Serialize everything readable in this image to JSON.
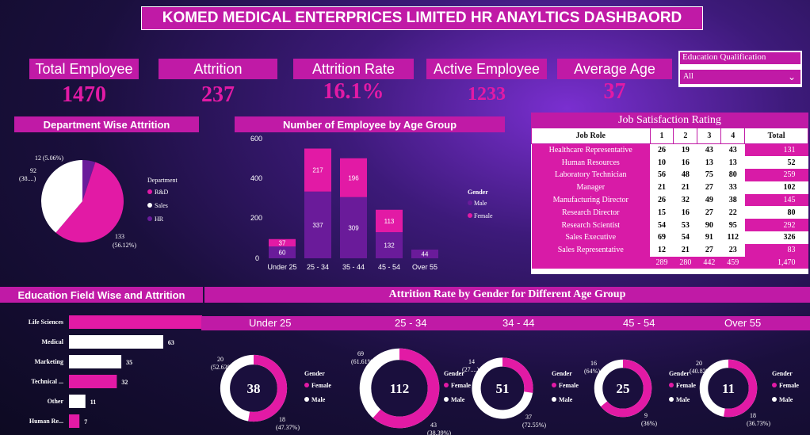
{
  "title": "KOMED MEDICAL ENTERPRICES LIMITED HR ANAYLTICS DASHBAORD",
  "kpis": [
    {
      "label": "Total Employee",
      "value": "1470"
    },
    {
      "label": "Attrition",
      "value": "237"
    },
    {
      "label": "Attrition Rate",
      "value": "16.1%"
    },
    {
      "label": "Active Employee",
      "value": "1233"
    },
    {
      "label": "Average Age",
      "value": "37"
    }
  ],
  "filter": {
    "label": "Education Qualification",
    "value": "All"
  },
  "dept_chart": {
    "title": "Department Wise Attrition",
    "legend_title": "Department",
    "slices": [
      {
        "name": "R&D",
        "value": 133,
        "label": "133",
        "pct": "(56.12%)",
        "color": "#e21aa5"
      },
      {
        "name": "Sales",
        "value": 92,
        "label": "92",
        "pct": "(38....)",
        "color": "#ffffff"
      },
      {
        "name": "HR",
        "value": 12,
        "label": "12 (5.06%)",
        "pct": "",
        "color": "#6a1b9a"
      }
    ]
  },
  "chart_data": [
    {
      "type": "bar",
      "title": "Number of Employee by Age Group",
      "categories": [
        "Under 25",
        "25 - 34",
        "35 - 44",
        "45 - 54",
        "Over 55"
      ],
      "series": [
        {
          "name": "Male",
          "values": [
            60,
            337,
            309,
            132,
            44
          ],
          "color": "#6a1b9a"
        },
        {
          "name": "Female",
          "values": [
            37,
            217,
            196,
            113,
            0
          ],
          "color": "#e21aa5"
        }
      ],
      "ylim": [
        0,
        600
      ],
      "yticks": [
        "600",
        "400",
        "200",
        "0"
      ],
      "legend_title": "Gender"
    },
    {
      "type": "bar",
      "title": "Education Field Wise and Attrition",
      "categories": [
        "Life Sciences",
        "Medical",
        "Marketing",
        "Technical ...",
        "Other",
        "Human Re..."
      ],
      "values": [
        89,
        63,
        35,
        32,
        11,
        7
      ],
      "colors": [
        "#e21aa5",
        "#ffffff",
        "#ffffff",
        "#e21aa5",
        "#ffffff",
        "#e21aa5"
      ]
    }
  ],
  "job_table": {
    "title": "Job Satisfaction  Rating",
    "headers": [
      "Job Role",
      "1",
      "2",
      "3",
      "4",
      "Total"
    ],
    "rows": [
      [
        "Healthcare Representative",
        "26",
        "19",
        "43",
        "43",
        "131"
      ],
      [
        "Human Resources",
        "10",
        "16",
        "13",
        "13",
        "52"
      ],
      [
        "Laboratory Technician",
        "56",
        "48",
        "75",
        "80",
        "259"
      ],
      [
        "Manager",
        "21",
        "21",
        "27",
        "33",
        "102"
      ],
      [
        "Manufacturing Director",
        "26",
        "32",
        "49",
        "38",
        "145"
      ],
      [
        "Research Director",
        "15",
        "16",
        "27",
        "22",
        "80"
      ],
      [
        "Research Scientist",
        "54",
        "53",
        "90",
        "95",
        "292"
      ],
      [
        "Sales Executive",
        "69",
        "54",
        "91",
        "112",
        "326"
      ],
      [
        "Sales Representative",
        "12",
        "21",
        "27",
        "23",
        "83"
      ]
    ],
    "totals": [
      "",
      "289",
      "280",
      "442",
      "459",
      "1,470"
    ]
  },
  "gender_section": {
    "title": "Attrition Rate by Gender for Different Age Group",
    "legend_title": "Gender",
    "legend_female": "Female",
    "legend_male": "Male",
    "groups": [
      {
        "label": "Under 25",
        "total": "38",
        "female": 20,
        "male": 18,
        "female_label": "20",
        "female_pct": "(52.63%)",
        "male_label": "18",
        "male_pct": "(47.37%)"
      },
      {
        "label": "25 - 34",
        "total": "112",
        "female": 69,
        "male": 43,
        "female_label": "69",
        "female_pct": "(61.61%)",
        "male_label": "43",
        "male_pct": "(38.39%)"
      },
      {
        "label": "34 - 44",
        "total": "51",
        "female": 14,
        "male": 37,
        "female_label": "14",
        "female_pct": "(27....)",
        "male_label": "37",
        "male_pct": "(72.55%)"
      },
      {
        "label": "45 - 54",
        "total": "25",
        "female": 16,
        "male": 9,
        "female_label": "16",
        "female_pct": "(64%)",
        "male_label": "9",
        "male_pct": "(36%)"
      },
      {
        "label": "Over 55",
        "total": "11",
        "female": 20,
        "male": 18,
        "female_label": "20",
        "female_pct": "(40.82%)",
        "male_label": "18",
        "male_pct": "(36.73%)"
      }
    ]
  }
}
